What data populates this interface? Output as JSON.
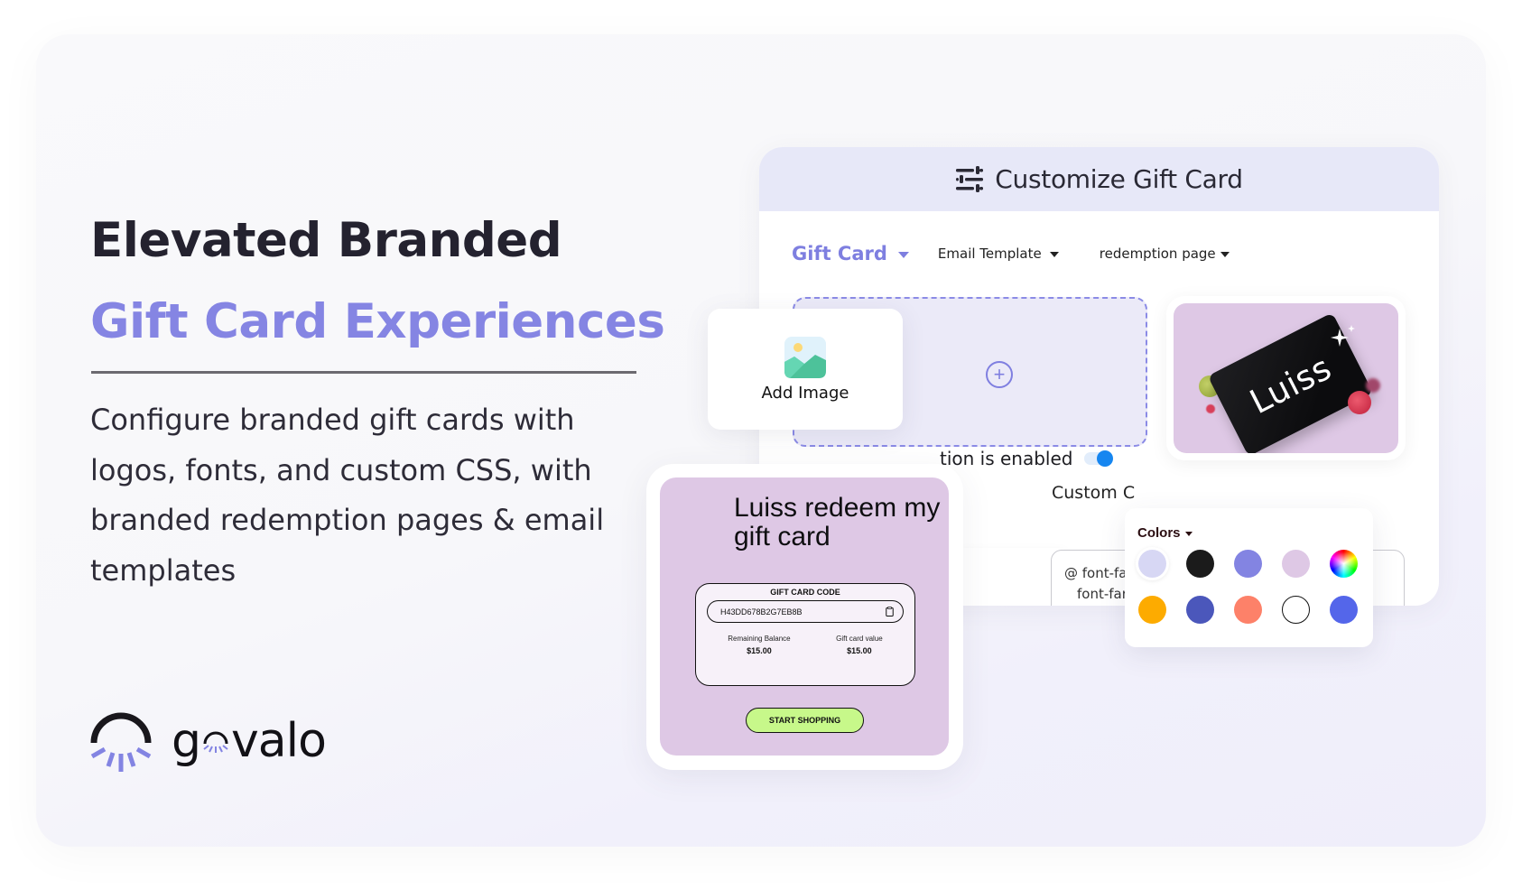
{
  "hero": {
    "headline_dark": "Elevated Branded ",
    "headline_accent": "Gift Card Experiences",
    "description": "Configure branded gift cards with logos, fonts, and custom CSS, with branded redemption pages & email templates"
  },
  "brand": {
    "wordmark_prefix": "g",
    "wordmark_suffix": "valo",
    "name": "govalo",
    "accent_color": "#8585e3"
  },
  "customize_card": {
    "title": "Customize Gift Card",
    "header_icon": "sliders-icon",
    "tabs": [
      {
        "label": "Gift Card",
        "active": true
      },
      {
        "label": "Email Template",
        "active": false
      },
      {
        "label": "redemption page",
        "active": false
      }
    ],
    "toggle_label_visible": "tion is enabled",
    "toggle_on": true,
    "custom_css_label_visible": "Custom C",
    "css_lines_visible": [
      "@ font-fa",
      "font-far"
    ]
  },
  "add_image": {
    "label": "Add Image",
    "icon": "image-icon"
  },
  "gift_card_preview": {
    "brand_text": "Luiss"
  },
  "redemption_preview": {
    "title": "Luiss redeem my gift card",
    "code_heading": "GIFT CARD CODE",
    "code": "H43DD678B2G7EB8B",
    "remaining_label": "Remaining Balance",
    "remaining_value": "$15.00",
    "value_label": "Gift card value",
    "value_value": "$15.00",
    "cta": "START SHOPPING"
  },
  "colors_popover": {
    "title": "Colors",
    "swatches": [
      {
        "name": "lavender-light",
        "color": "#d7d7f4"
      },
      {
        "name": "black",
        "color": "#1b1b1b"
      },
      {
        "name": "periwinkle",
        "color": "#8384e2"
      },
      {
        "name": "lilac",
        "color": "#dec8e5"
      },
      {
        "name": "color-wheel",
        "color": "conic"
      },
      {
        "name": "amber",
        "color": "#fdab00"
      },
      {
        "name": "indigo",
        "color": "#4b57bb"
      },
      {
        "name": "coral",
        "color": "#fd8169"
      },
      {
        "name": "white",
        "color": "#ffffff"
      },
      {
        "name": "royal-blue",
        "color": "#5466ea"
      }
    ]
  }
}
